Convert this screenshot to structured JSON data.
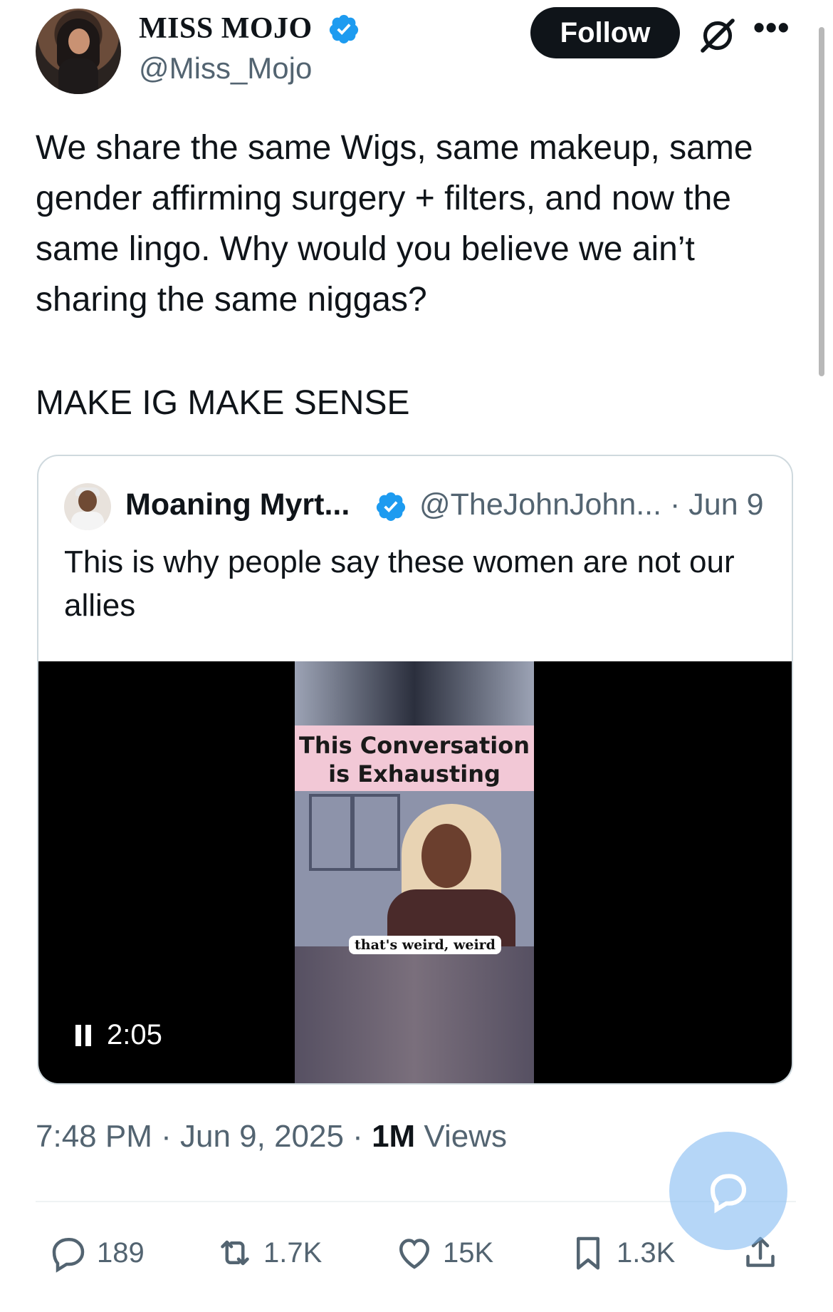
{
  "author": {
    "display_name": "MISS MOJO",
    "handle": "@Miss_Mojo",
    "verified": true,
    "avatar": "avatar-photo-woman"
  },
  "header": {
    "follow_label": "Follow",
    "grok_icon": "grok-icon",
    "more_icon": "more-icon",
    "more_label": "•••"
  },
  "tweet": {
    "text": "We share the same Wigs, same makeup, same gender affirming surgery + filters, and now the same lingo. Why would you believe we ain’t sharing the same niggas?",
    "text2": "MAKE IG MAKE SENSE"
  },
  "quote": {
    "display_name": "Moaning Myrt...",
    "meta": "@TheJohnJohn... · Jun 9",
    "verified": true,
    "text": "This is why people say these women are not our allies",
    "video": {
      "caption": "This Conversation is Exhausting",
      "subtitle": "that's weird, weird",
      "time": "2:05",
      "state_icon": "pause-icon"
    }
  },
  "meta": {
    "time": "7:48 PM",
    "date": "Jun 9, 2025",
    "views_count": "1M",
    "views_label": "Views",
    "separator": " · "
  },
  "actions": {
    "replies": "189",
    "retweets": "1.7K",
    "likes": "15K",
    "bookmarks": "1.3K"
  },
  "colors": {
    "verified": "#1d9bf0",
    "text_primary": "#0f1419",
    "text_secondary": "#536471",
    "fab": "#78b4f0"
  }
}
